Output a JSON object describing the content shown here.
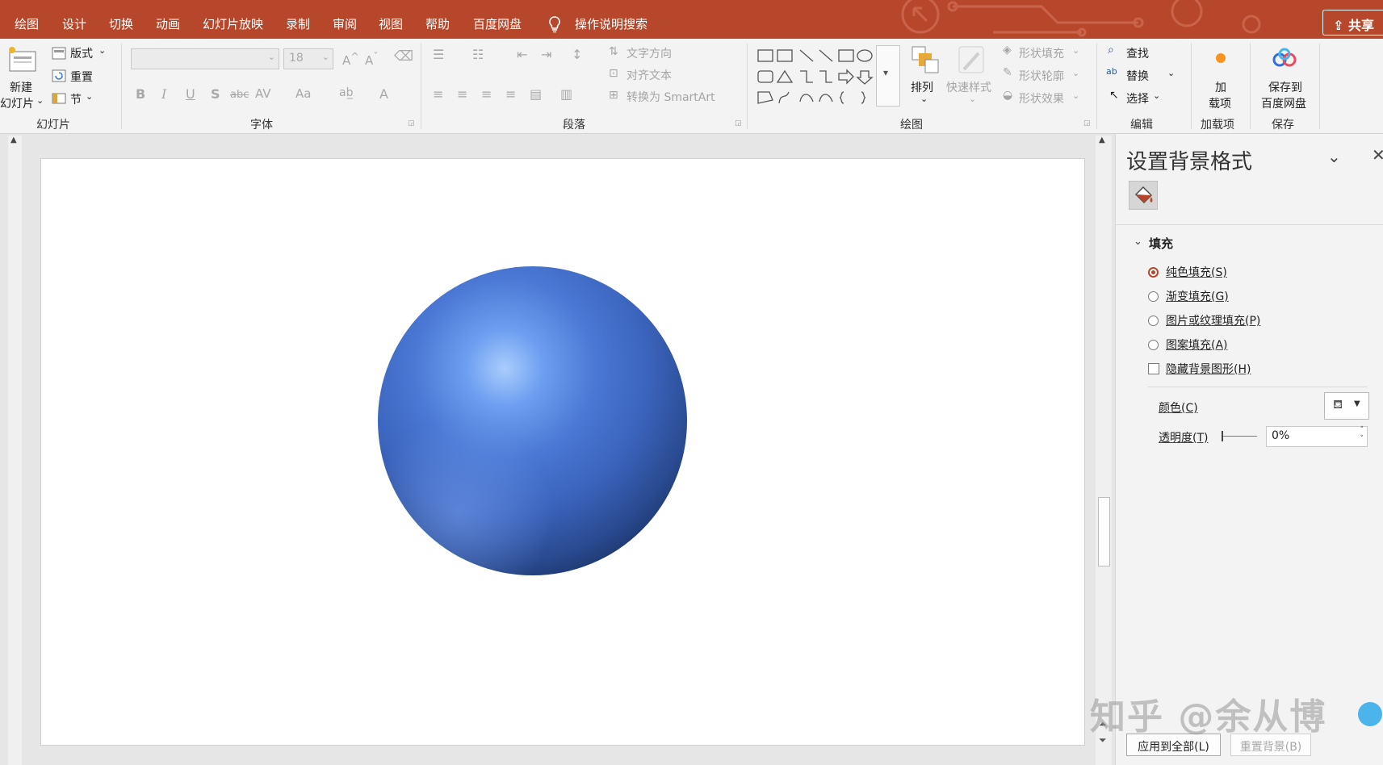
{
  "tabs": [
    "绘图",
    "设计",
    "切换",
    "动画",
    "幻灯片放映",
    "录制",
    "审阅",
    "视图",
    "帮助",
    "百度网盘"
  ],
  "search": {
    "label": "操作说明搜索"
  },
  "share": {
    "label": "共享"
  },
  "ribbon": {
    "slides": {
      "new_slide_1": "新建",
      "new_slide_2": "幻灯片",
      "layout": "版式",
      "reset": "重置",
      "section": "节",
      "group": "幻灯片"
    },
    "font": {
      "size": "18",
      "group": "字体",
      "buttons": [
        "B",
        "I",
        "U",
        "S",
        "abc",
        "AV",
        "Aa",
        "A"
      ]
    },
    "paragraph": {
      "text_direction": "文字方向",
      "align_text": "对齐文本",
      "smartart": "转换为 SmartArt",
      "group": "段落"
    },
    "drawing": {
      "arrange": "排列",
      "quick_styles": "快速样式",
      "shape_fill": "形状填充",
      "shape_outline": "形状轮廓",
      "shape_effects": "形状效果",
      "group": "绘图"
    },
    "editing": {
      "find": "查找",
      "replace": "替换",
      "select": "选择",
      "group": "编辑"
    },
    "addins": {
      "label_1": "加",
      "label_2": "载项",
      "group": "加载项"
    },
    "save": {
      "label_1": "保存到",
      "label_2": "百度网盘",
      "group": "保存"
    }
  },
  "pane": {
    "title": "设置背景格式",
    "section": "填充",
    "options": [
      "纯色填充(S)",
      "渐变填充(G)",
      "图片或纹理填充(P)",
      "图案填充(A)"
    ],
    "hide_graphics": "隐藏背景图形(H)",
    "color_label": "颜色(C)",
    "transparency_label": "透明度(T)",
    "transparency_value": "0%",
    "apply_all": "应用到全部(L)",
    "reset_bg": "重置背景(B)"
  },
  "watermark": "知乎 @余从博",
  "colors": {
    "accent": "#b7472a",
    "sphere": "#3b64bd"
  }
}
